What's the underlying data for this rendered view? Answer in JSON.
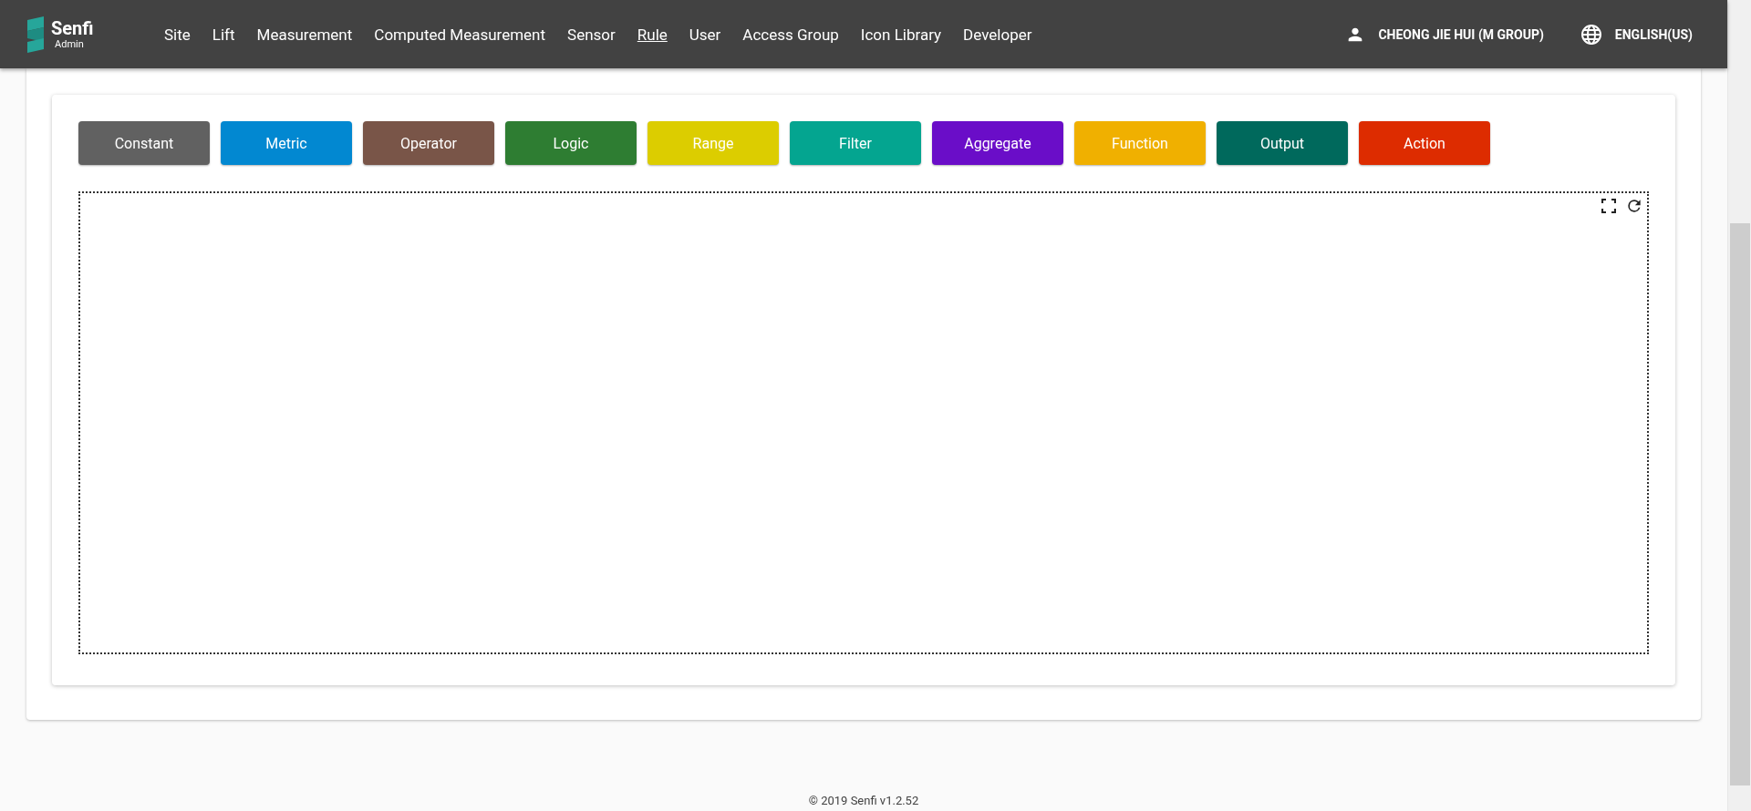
{
  "header": {
    "logo": {
      "name": "Senfi",
      "subtitle": "Admin"
    },
    "nav": [
      {
        "label": "Site",
        "selected": false
      },
      {
        "label": "Lift",
        "selected": false
      },
      {
        "label": "Measurement",
        "selected": false
      },
      {
        "label": "Computed Measurement",
        "selected": false
      },
      {
        "label": "Sensor",
        "selected": false
      },
      {
        "label": "Rule",
        "selected": true
      },
      {
        "label": "User",
        "selected": false
      },
      {
        "label": "Access Group",
        "selected": false
      },
      {
        "label": "Icon Library",
        "selected": false
      },
      {
        "label": "Developer",
        "selected": false
      }
    ],
    "user": "CHEONG JIE HUI (M GROUP)",
    "language": "ENGLISH(US)"
  },
  "palette": [
    {
      "label": "Constant",
      "color": "#616161"
    },
    {
      "label": "Metric",
      "color": "#0288d1"
    },
    {
      "label": "Operator",
      "color": "#795548"
    },
    {
      "label": "Logic",
      "color": "#2e7d32"
    },
    {
      "label": "Range",
      "color": "#dccd00"
    },
    {
      "label": "Filter",
      "color": "#04a590"
    },
    {
      "label": "Aggregate",
      "color": "#6a0dc8"
    },
    {
      "label": "Function",
      "color": "#f0b000"
    },
    {
      "label": "Output",
      "color": "#00695c"
    },
    {
      "label": "Action",
      "color": "#dd2c00"
    }
  ],
  "footer": "© 2019 Senfi v1.2.52"
}
